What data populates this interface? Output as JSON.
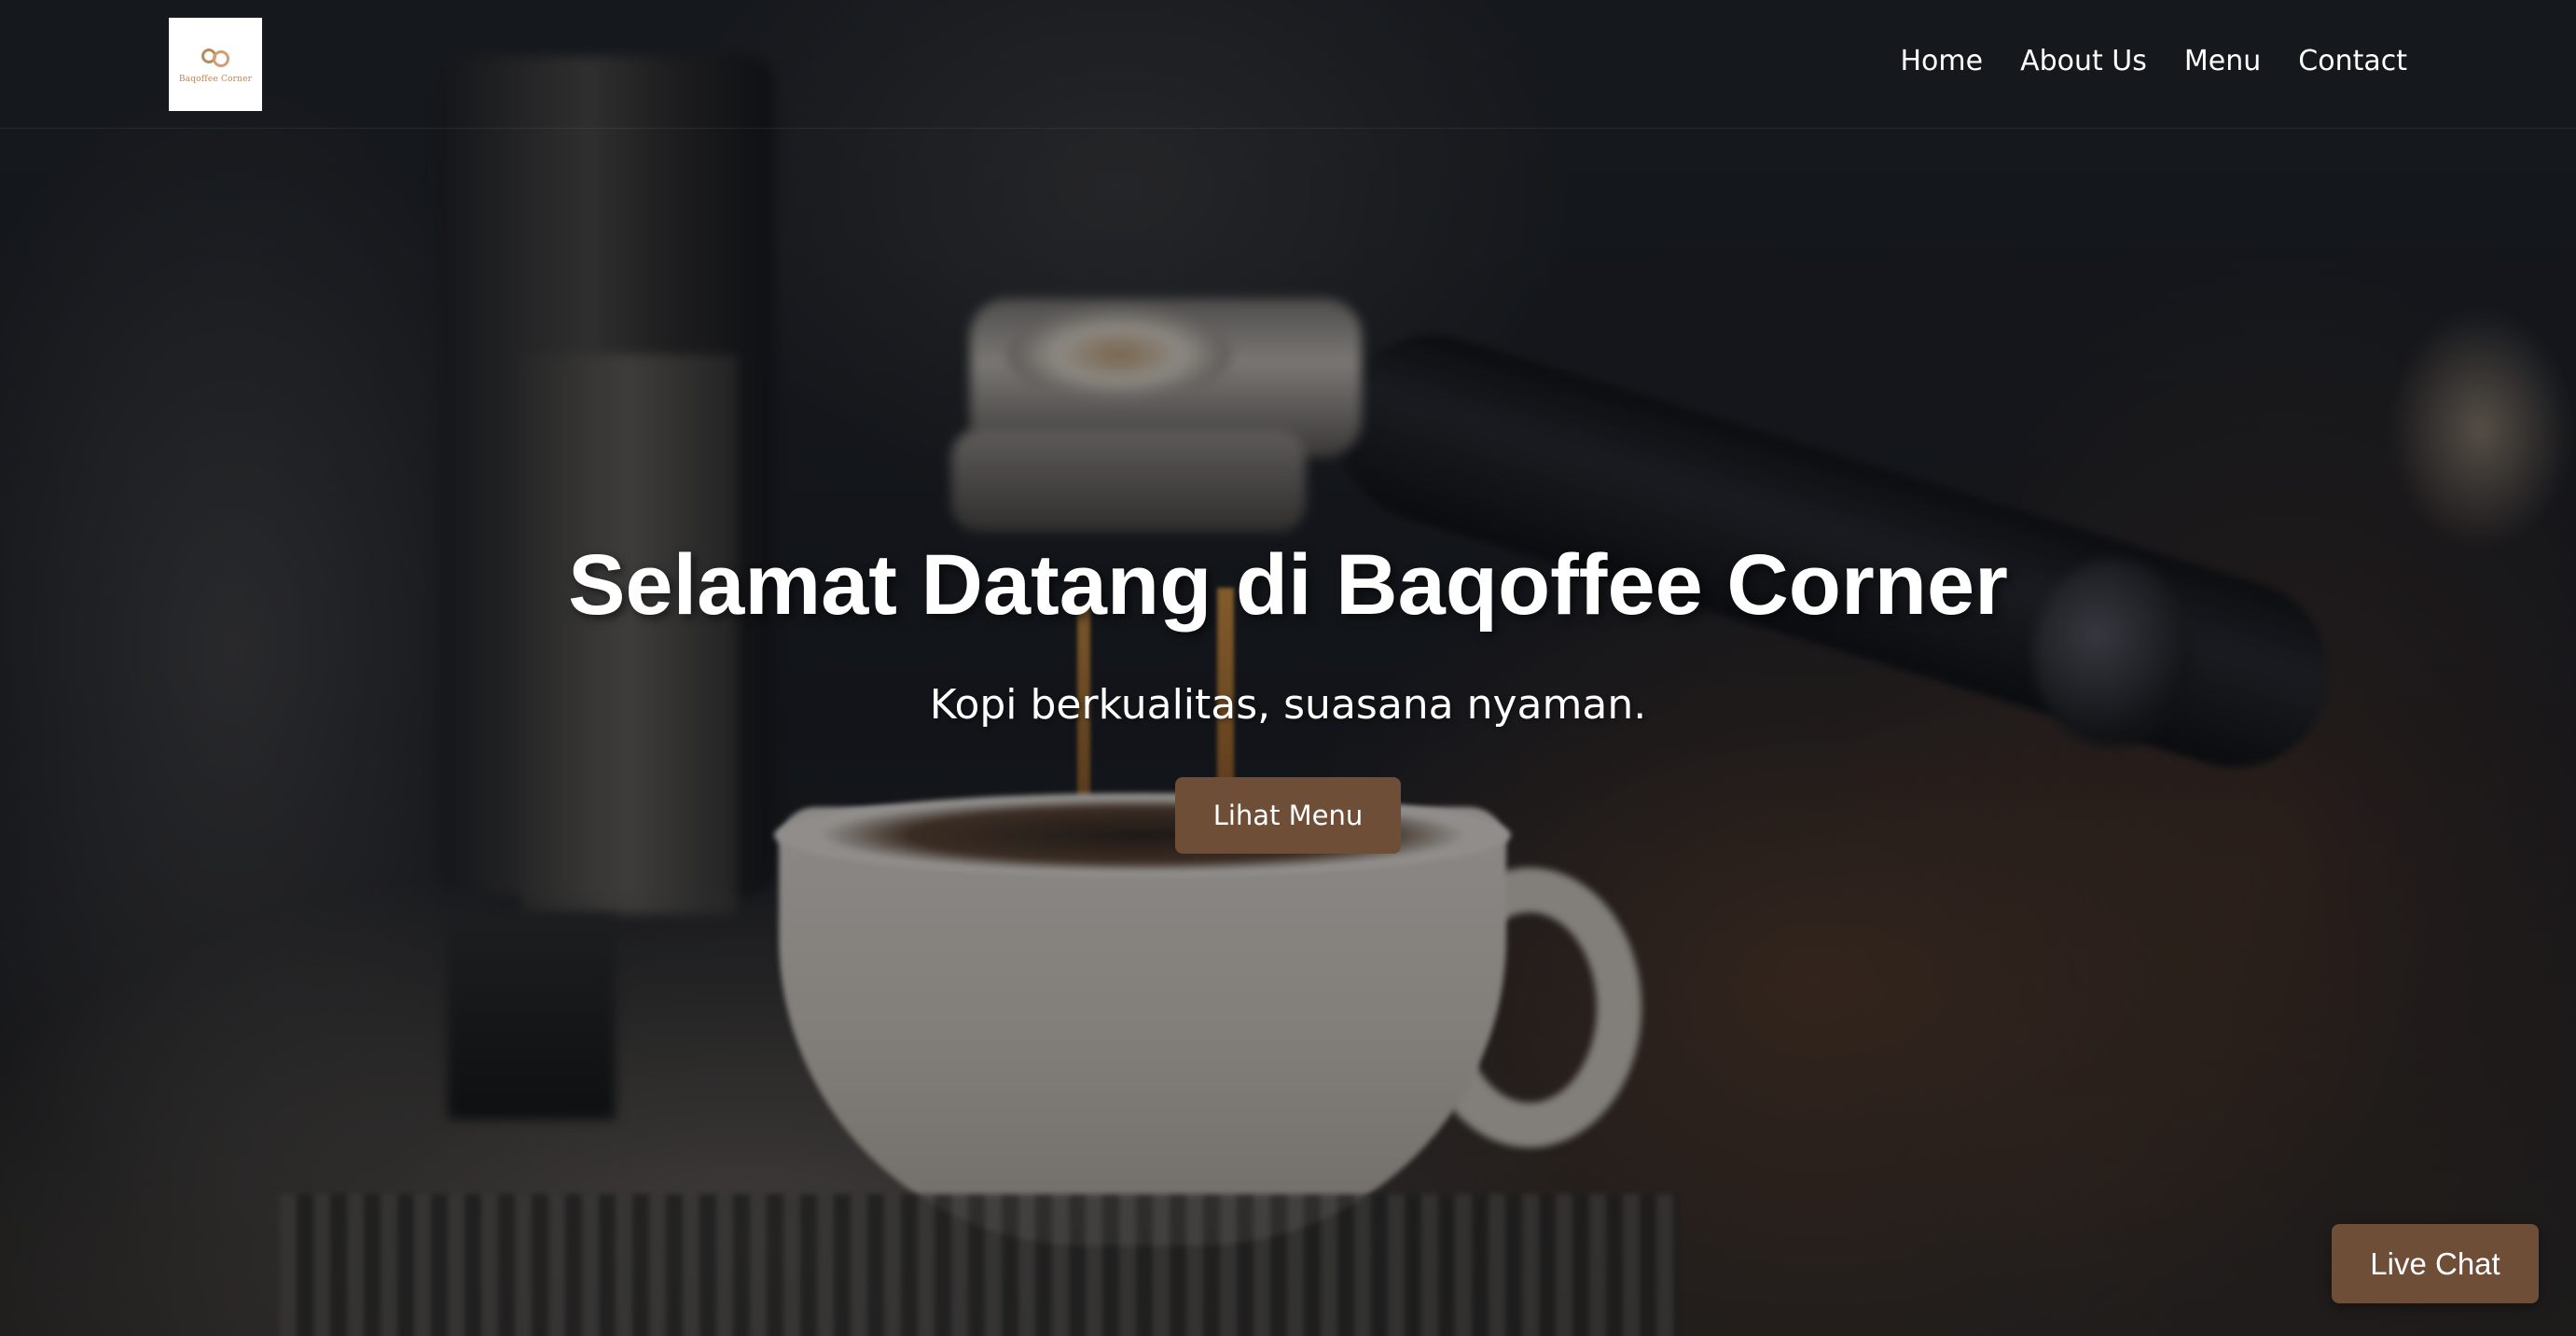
{
  "header": {
    "logo_text": "Baqoffee Corner",
    "nav": [
      {
        "label": "Home"
      },
      {
        "label": "About Us"
      },
      {
        "label": "Menu"
      },
      {
        "label": "Contact"
      }
    ]
  },
  "hero": {
    "title": "Selamat Datang di Baqoffee Corner",
    "subtitle": "Kopi berkualitas, suasana nyaman.",
    "button_label": "Lihat Menu"
  },
  "live_chat": {
    "label": "Live Chat"
  },
  "colors": {
    "accent": "#6f4e37",
    "text": "#ffffff",
    "logo_bg": "#ffffff"
  },
  "icons": {
    "logo": "coffee-bean-logo-icon"
  }
}
